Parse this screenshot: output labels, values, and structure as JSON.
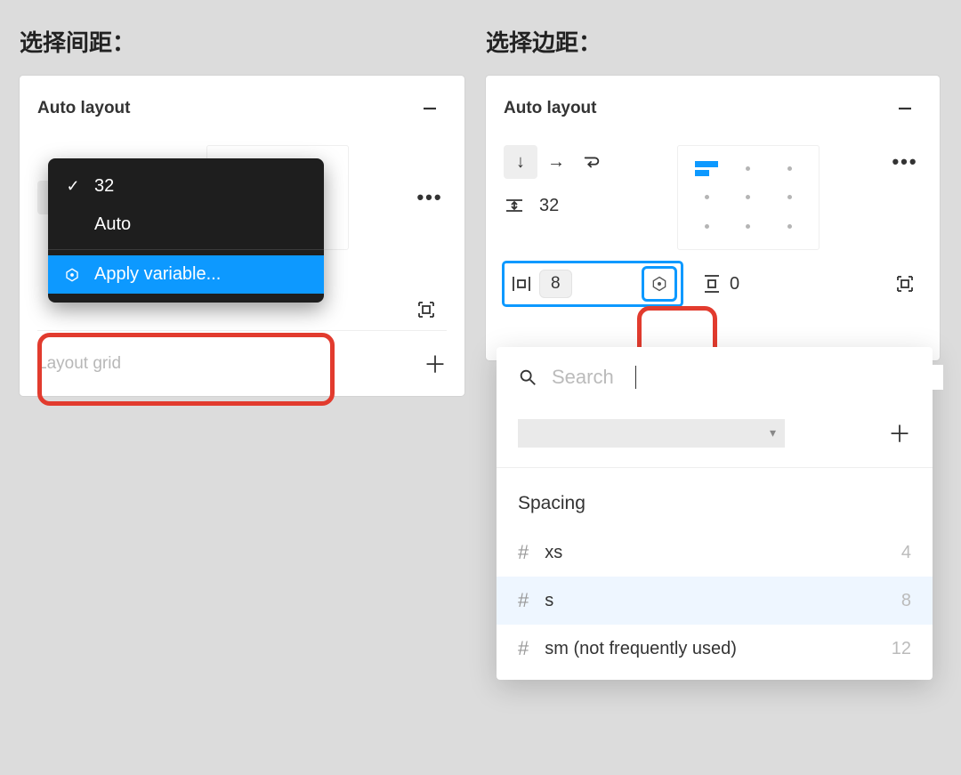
{
  "left": {
    "title": "选择间距：",
    "panel_title": "Auto layout",
    "menu": {
      "selected": "32",
      "auto": "Auto",
      "apply_variable": "Apply variable..."
    },
    "layout_grid_label": "Layout grid"
  },
  "right": {
    "title": "选择边距：",
    "panel_title": "Auto layout",
    "gap_value": "32",
    "horizontal_padding": "8",
    "vertical_padding": "0",
    "picker": {
      "search_placeholder": "Search",
      "group_label": "Spacing",
      "items": [
        {
          "name": "xs",
          "value": "4"
        },
        {
          "name": "s",
          "value": "8"
        },
        {
          "name": "sm (not frequently used)",
          "value": "12"
        }
      ]
    }
  }
}
